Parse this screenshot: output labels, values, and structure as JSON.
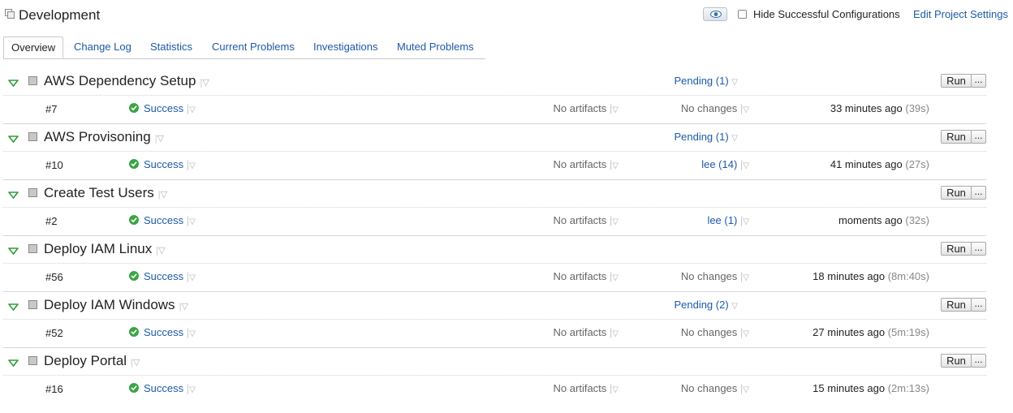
{
  "header": {
    "title": "Development",
    "hide_successful_label": "Hide Successful Configurations",
    "edit_settings_label": "Edit Project Settings"
  },
  "tabs": [
    {
      "label": "Overview",
      "active": true
    },
    {
      "label": "Change Log"
    },
    {
      "label": "Statistics"
    },
    {
      "label": "Current Problems"
    },
    {
      "label": "Investigations"
    },
    {
      "label": "Muted Problems"
    }
  ],
  "buttons": {
    "run": "Run",
    "more": "..."
  },
  "configs": [
    {
      "name": "AWS Dependency Setup",
      "pending": "Pending (1)",
      "build": "#7",
      "status": "Success",
      "artifacts": "No artifacts",
      "changes": "No changes",
      "changes_link": false,
      "time": "33 minutes ago",
      "duration": "(39s)"
    },
    {
      "name": "AWS Provisoning",
      "pending": "Pending (1)",
      "build": "#10",
      "status": "Success",
      "artifacts": "No artifacts",
      "changes": "lee (14)",
      "changes_link": true,
      "time": "41 minutes ago",
      "duration": "(27s)"
    },
    {
      "name": "Create Test Users",
      "pending": "",
      "build": "#2",
      "status": "Success",
      "artifacts": "No artifacts",
      "changes": "lee (1)",
      "changes_link": true,
      "time": "moments ago",
      "duration": "(32s)"
    },
    {
      "name": "Deploy IAM Linux",
      "pending": "",
      "build": "#56",
      "status": "Success",
      "artifacts": "No artifacts",
      "changes": "No changes",
      "changes_link": false,
      "time": "18 minutes ago",
      "duration": "(8m:40s)"
    },
    {
      "name": "Deploy IAM Windows",
      "pending": "Pending (2)",
      "build": "#52",
      "status": "Success",
      "artifacts": "No artifacts",
      "changes": "No changes",
      "changes_link": false,
      "time": "27 minutes ago",
      "duration": "(5m:19s)"
    },
    {
      "name": "Deploy Portal",
      "pending": "",
      "build": "#16",
      "status": "Success",
      "artifacts": "No artifacts",
      "changes": "No changes",
      "changes_link": false,
      "time": "15 minutes ago",
      "duration": "(2m:13s)"
    }
  ],
  "colors": {
    "link": "#1e5aa6",
    "success": "#3aa545",
    "expander": "#2e9e3e"
  },
  "icons": {
    "project": "project-icon",
    "eye": "eye-icon",
    "expander": "expand-triangle-icon",
    "status": "success-check-icon"
  }
}
